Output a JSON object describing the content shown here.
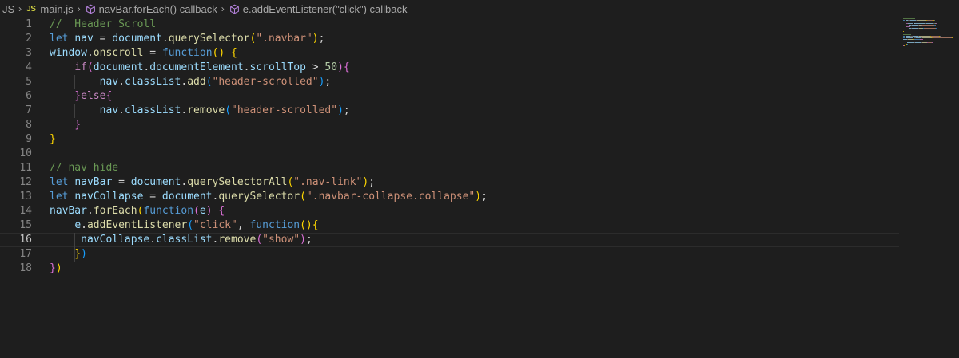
{
  "breadcrumb": {
    "folder": "JS",
    "file_badge": "JS",
    "file": "main.js",
    "scope1": "navBar.forEach() callback",
    "scope2": "e.addEventListener(\"click\") callback"
  },
  "editor": {
    "current_line": 16,
    "lines": [
      {
        "n": "1",
        "tokens": [
          [
            "com",
            "//  Header Scroll"
          ]
        ]
      },
      {
        "n": "2",
        "tokens": [
          [
            "kw",
            "let"
          ],
          [
            "txt",
            " "
          ],
          [
            "var",
            "nav"
          ],
          [
            "txt",
            " = "
          ],
          [
            "var",
            "document"
          ],
          [
            "txt",
            "."
          ],
          [
            "fn",
            "querySelector"
          ],
          [
            "p1",
            "("
          ],
          [
            "str",
            "\".navbar\""
          ],
          [
            "p1",
            ")"
          ],
          [
            "txt",
            ";"
          ]
        ]
      },
      {
        "n": "3",
        "tokens": [
          [
            "var",
            "window"
          ],
          [
            "txt",
            "."
          ],
          [
            "fn",
            "onscroll"
          ],
          [
            "txt",
            " = "
          ],
          [
            "kw",
            "function"
          ],
          [
            "p1",
            "()"
          ],
          [
            "txt",
            " "
          ],
          [
            "p1",
            "{"
          ]
        ]
      },
      {
        "n": "4",
        "tokens": [
          [
            "txt",
            "    "
          ],
          [
            "ctrl",
            "if"
          ],
          [
            "p2",
            "("
          ],
          [
            "var",
            "document"
          ],
          [
            "txt",
            "."
          ],
          [
            "var",
            "documentElement"
          ],
          [
            "txt",
            "."
          ],
          [
            "var",
            "scrollTop"
          ],
          [
            "txt",
            " > "
          ],
          [
            "num",
            "50"
          ],
          [
            "p2",
            ")"
          ],
          [
            "p2",
            "{"
          ]
        ]
      },
      {
        "n": "5",
        "tokens": [
          [
            "txt",
            "        "
          ],
          [
            "var",
            "nav"
          ],
          [
            "txt",
            "."
          ],
          [
            "var",
            "classList"
          ],
          [
            "txt",
            "."
          ],
          [
            "fn",
            "add"
          ],
          [
            "p3",
            "("
          ],
          [
            "str",
            "\"header-scrolled\""
          ],
          [
            "p3",
            ")"
          ],
          [
            "txt",
            ";"
          ]
        ]
      },
      {
        "n": "6",
        "tokens": [
          [
            "txt",
            "    "
          ],
          [
            "p2",
            "}"
          ],
          [
            "ctrl",
            "else"
          ],
          [
            "p2",
            "{"
          ]
        ]
      },
      {
        "n": "7",
        "tokens": [
          [
            "txt",
            "        "
          ],
          [
            "var",
            "nav"
          ],
          [
            "txt",
            "."
          ],
          [
            "var",
            "classList"
          ],
          [
            "txt",
            "."
          ],
          [
            "fn",
            "remove"
          ],
          [
            "p3",
            "("
          ],
          [
            "str",
            "\"header-scrolled\""
          ],
          [
            "p3",
            ")"
          ],
          [
            "txt",
            ";"
          ]
        ]
      },
      {
        "n": "8",
        "tokens": [
          [
            "txt",
            "    "
          ],
          [
            "p2",
            "}"
          ]
        ]
      },
      {
        "n": "9",
        "tokens": [
          [
            "p1",
            "}"
          ]
        ]
      },
      {
        "n": "10",
        "tokens": []
      },
      {
        "n": "11",
        "tokens": [
          [
            "com",
            "// nav hide"
          ]
        ]
      },
      {
        "n": "12",
        "tokens": [
          [
            "kw",
            "let"
          ],
          [
            "txt",
            " "
          ],
          [
            "var",
            "navBar"
          ],
          [
            "txt",
            " = "
          ],
          [
            "var",
            "document"
          ],
          [
            "txt",
            "."
          ],
          [
            "fn",
            "querySelectorAll"
          ],
          [
            "p1",
            "("
          ],
          [
            "str",
            "\".nav-link\""
          ],
          [
            "p1",
            ")"
          ],
          [
            "txt",
            ";"
          ]
        ]
      },
      {
        "n": "13",
        "tokens": [
          [
            "kw",
            "let"
          ],
          [
            "txt",
            " "
          ],
          [
            "var",
            "navCollapse"
          ],
          [
            "txt",
            " = "
          ],
          [
            "var",
            "document"
          ],
          [
            "txt",
            "."
          ],
          [
            "fn",
            "querySelector"
          ],
          [
            "p1",
            "("
          ],
          [
            "str",
            "\".navbar-collapse.collapse\""
          ],
          [
            "p1",
            ")"
          ],
          [
            "txt",
            ";"
          ]
        ]
      },
      {
        "n": "14",
        "tokens": [
          [
            "var",
            "navBar"
          ],
          [
            "txt",
            "."
          ],
          [
            "fn",
            "forEach"
          ],
          [
            "p1",
            "("
          ],
          [
            "kw",
            "function"
          ],
          [
            "p2",
            "("
          ],
          [
            "var",
            "e"
          ],
          [
            "p2",
            ")"
          ],
          [
            "txt",
            " "
          ],
          [
            "p2",
            "{"
          ]
        ]
      },
      {
        "n": "15",
        "tokens": [
          [
            "txt",
            "    "
          ],
          [
            "var",
            "e"
          ],
          [
            "txt",
            "."
          ],
          [
            "fn",
            "addEventListener"
          ],
          [
            "p3",
            "("
          ],
          [
            "str",
            "\"click\""
          ],
          [
            "txt",
            ", "
          ],
          [
            "kw",
            "function"
          ],
          [
            "p1",
            "()"
          ],
          [
            "p1",
            "{"
          ]
        ]
      },
      {
        "n": "16",
        "tokens": [
          [
            "txt",
            "     "
          ],
          [
            "var",
            "navCollapse"
          ],
          [
            "txt",
            "."
          ],
          [
            "var",
            "classList"
          ],
          [
            "txt",
            "."
          ],
          [
            "fn",
            "remove"
          ],
          [
            "p2",
            "("
          ],
          [
            "str",
            "\"show\""
          ],
          [
            "p2",
            ")"
          ],
          [
            "txt",
            ";"
          ]
        ]
      },
      {
        "n": "17",
        "tokens": [
          [
            "txt",
            "    "
          ],
          [
            "p1",
            "}"
          ],
          [
            "p3",
            ")"
          ]
        ]
      },
      {
        "n": "18",
        "tokens": [
          [
            "p2",
            "}"
          ],
          [
            "p1",
            ")"
          ]
        ]
      }
    ]
  },
  "colors": {
    "background": "#1e1e1e",
    "keyword": "#569cd6",
    "control": "#c586c0",
    "variable": "#9cdcfe",
    "function": "#dcdcaa",
    "string": "#ce9178",
    "number": "#b5cea8",
    "comment": "#6a9955"
  }
}
